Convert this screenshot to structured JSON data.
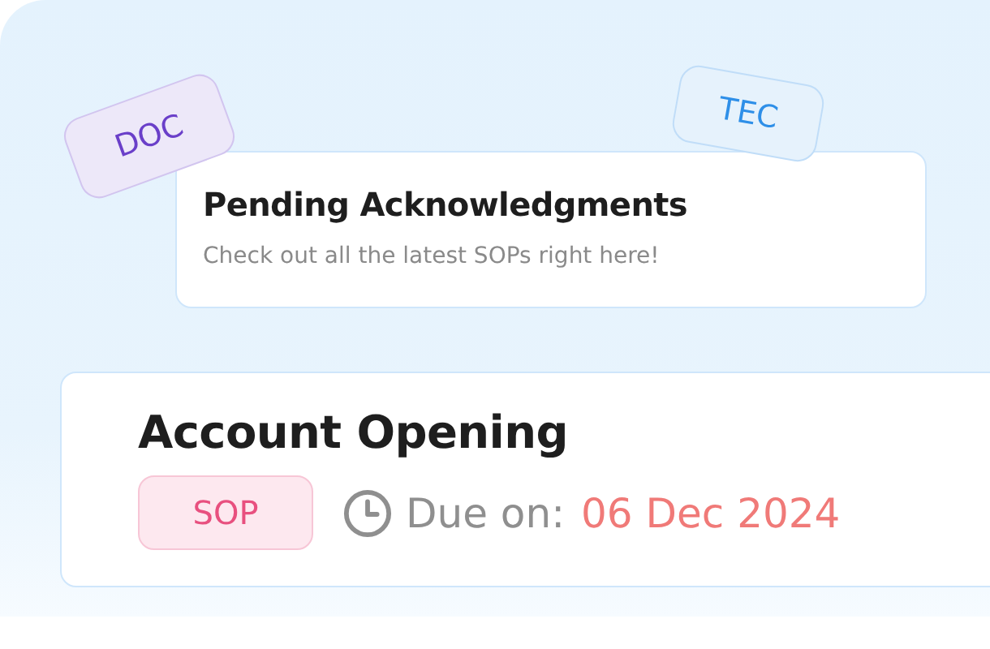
{
  "floating_tags": [
    {
      "label": "DOC",
      "color": "#6a3fc9"
    },
    {
      "label": "TEC",
      "color": "#2e8fe8"
    }
  ],
  "notice": {
    "title": "Pending Acknowledgments",
    "subtitle": "Check out all the latest SOPs right here!"
  },
  "task": {
    "title": "Account Opening",
    "tag": "SOP",
    "due_label": "Due on:",
    "due_date": "06 Dec 2024"
  }
}
